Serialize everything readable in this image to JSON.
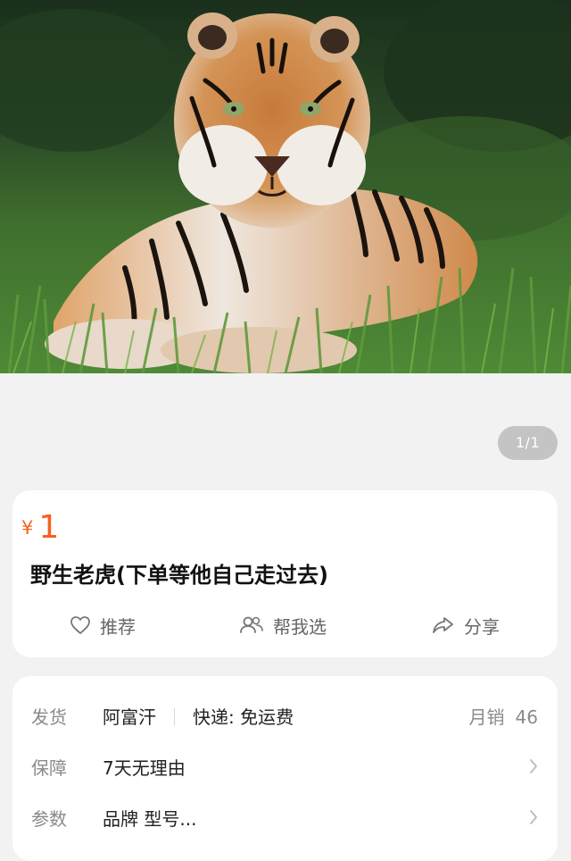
{
  "gallery": {
    "page_indicator": "1/1",
    "image_icon": "tiger-photo"
  },
  "product": {
    "currency": "¥",
    "price": "1",
    "title": "野生老虎(下单等他自己走过去)"
  },
  "actions": {
    "recommend_label": "推荐",
    "help_choose_label": "帮我选",
    "share_label": "分享"
  },
  "info": {
    "ship_label": "发货",
    "ship_from": "阿富汗",
    "delivery": "快递: 免运费",
    "monthly_sales_label": "月销",
    "monthly_sales": "46",
    "guarantee_label": "保障",
    "guarantee_value": "7天无理由",
    "params_label": "参数",
    "params_value": "品牌 型号..."
  },
  "colors": {
    "price": "#f5611e",
    "background": "#f2f2f2",
    "muted": "#8a8a8a"
  }
}
